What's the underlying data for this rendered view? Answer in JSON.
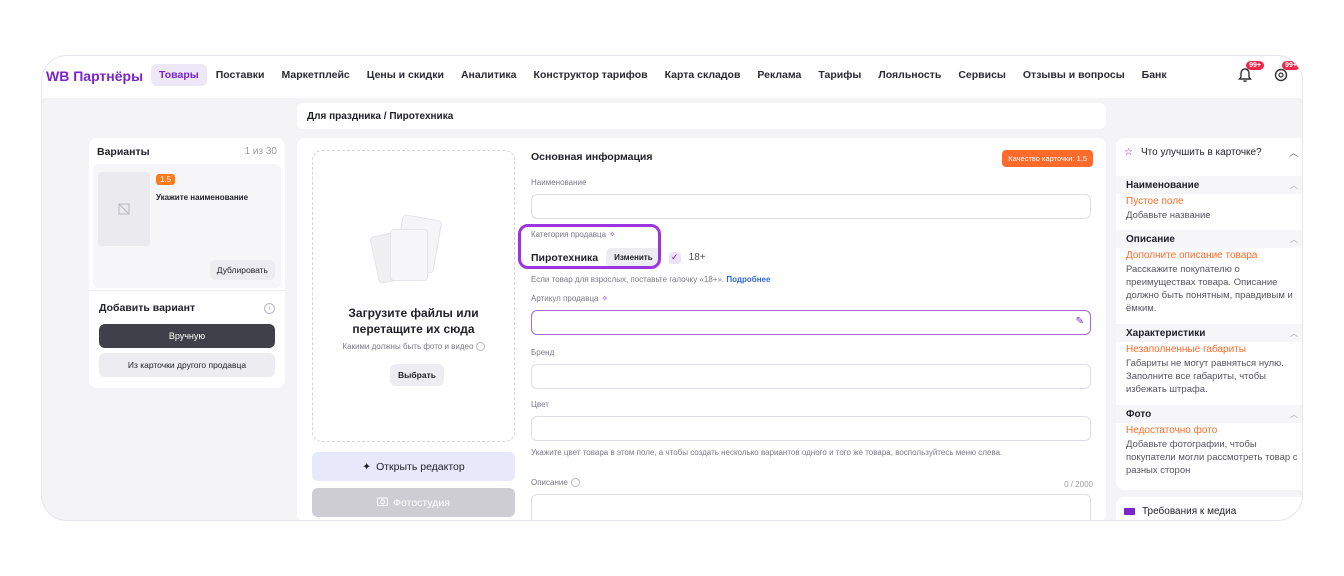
{
  "app": {
    "logo": "WB Партнёры"
  },
  "nav": {
    "items": [
      "Товары",
      "Поставки",
      "Маркетплейс",
      "Цены и скидки",
      "Аналитика",
      "Конструктор тарифов",
      "Карта складов",
      "Реклама",
      "Тарифы",
      "Лояльность",
      "Сервисы",
      "Отзывы и вопросы",
      "Банк"
    ],
    "active": "Товары",
    "notifications_badge": "99+",
    "support_badge": "99+"
  },
  "breadcrumb": "Для праздника  /  Пиротехника",
  "variants": {
    "title": "Варианты",
    "count": "1 из 30",
    "card": {
      "rating": "1.5",
      "name": "Укажите наименование",
      "duplicate_label": "Дублировать"
    },
    "add_title": "Добавить вариант",
    "manual_label": "Вручную",
    "from_other_label": "Из карточки другого продавца"
  },
  "upload": {
    "title": "Загрузите файлы или перетащите их сюда",
    "hint": "Какими должны быть фото и видео",
    "choose_label": "Выбрать",
    "editor_label": "Открыть редактор",
    "studio_label": "Фотостудия"
  },
  "form": {
    "section_title": "Основная информация",
    "quality_badge": "Качество карточки: 1.5",
    "name_label": "Наименование",
    "name_value": "",
    "category_label": "Категория продавца",
    "category_value": "Пиротехника",
    "change_label": "Изменить",
    "age_label": "18+",
    "adult_hint": "Если товар для взрослых, поставьте галочку «18+».",
    "adult_link": "Подробнее",
    "article_label": "Артикул продавца",
    "brand_label": "Бренд",
    "color_label": "Цвет",
    "color_hint": "Укажите цвет товара в этом поле, а чтобы создать несколько вариантов одного и того же товара, воспользуйтесь меню слева.",
    "description_label": "Описание",
    "description_count": "0 / 2000"
  },
  "tips": {
    "title": "Что улучшить в карточке?",
    "sections": [
      {
        "title": "Наименование",
        "warning": "Пустое поле",
        "text": "Добавьте название"
      },
      {
        "title": "Описание",
        "warning": "Дополните описание товара",
        "text": "Расскажите покупателю о преимуществах товара. Описание должно быть понятным, правдивым и ёмким."
      },
      {
        "title": "Характеристики",
        "warning": "Незаполненные габариты",
        "text": "Габариты не могут равняться нулю. Заполните все габариты, чтобы избежать штрафа."
      },
      {
        "title": "Фото",
        "warning": "Недостаточно фото",
        "text": "Добавьте фотографии, чтобы покупатели могли рассмотреть товар с разных сторон"
      }
    ],
    "media_title": "Требования к медиа"
  },
  "colors": {
    "brand": "#7a24c9",
    "accent_orange": "#ff6b2b",
    "highlight": "#9b35e0",
    "link": "#2f6bd9"
  }
}
